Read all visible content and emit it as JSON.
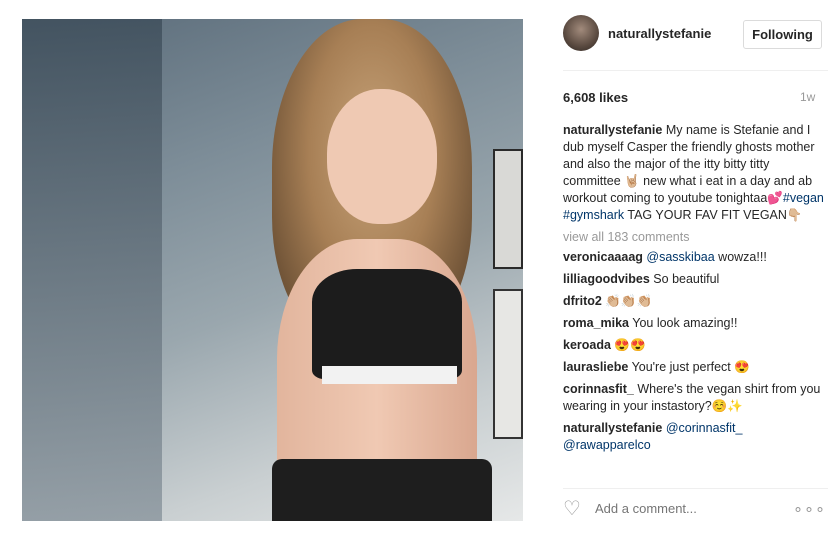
{
  "post": {
    "username": "naturallystefanie",
    "follow_label": "Following",
    "likes": "6,608 likes",
    "time_ago": "1w"
  },
  "caption": {
    "author": "naturallystefanie",
    "text_1": " My name is Stefanie and I dub myself Casper the friendly ghosts mother and also the major of the itty bitty titty committee 🤘🏼 new what i eat in a day and ab workout coming to youtube tonightaa💕",
    "hashtag_1": "#vegan",
    "hashtag_2": "#gymshark",
    "text_2": " TAG YOUR FAV FIT VEGAN👇🏼"
  },
  "view_all": "view all 183 comments",
  "comments": [
    {
      "user": "veronicaaaag",
      "mention": "@sasskibaa",
      "text": " wowza!!!"
    },
    {
      "user": "lilliagoodvibes",
      "mention": "",
      "text": " So beautiful"
    },
    {
      "user": "dfrito2",
      "mention": "",
      "text": " 👏🏼👏🏼👏🏼"
    },
    {
      "user": "roma_mika",
      "mention": "",
      "text": " You look amazing!!"
    },
    {
      "user": "keroada",
      "mention": "",
      "text": " 😍😍"
    },
    {
      "user": "laurasliebe",
      "mention": "",
      "text": " You're just perfect 😍"
    },
    {
      "user": "corinnasfit_",
      "mention": "",
      "text": " Where's the vegan shirt from you wearing in your instastory?☺️✨"
    },
    {
      "user": "naturallystefanie",
      "mention": "@corinnasfit_",
      "mention2": "@rawapparelco",
      "text": " "
    }
  ],
  "add_comment_placeholder": "Add a comment...",
  "icons": {
    "heart": "heart-outline-icon",
    "more": "more-options-icon"
  }
}
